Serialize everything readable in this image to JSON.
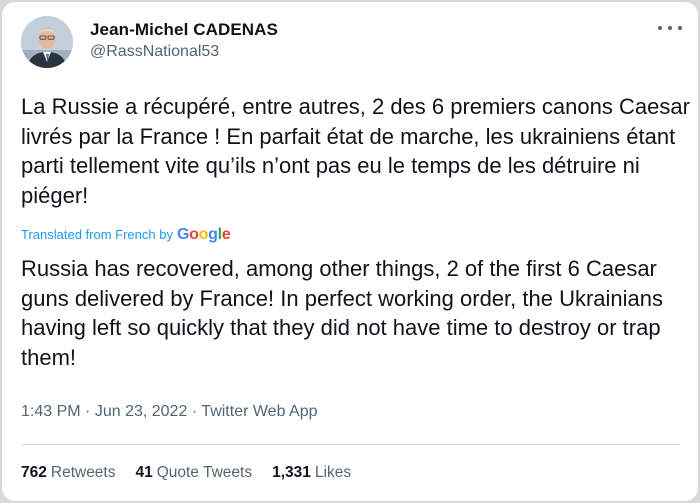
{
  "author": {
    "display_name": "Jean-Michel CADENAS",
    "handle": "@RassNational53",
    "avatar_icon": "profile-photo"
  },
  "tweet": {
    "text": "La Russie a récupéré, entre autres, 2 des 6 premiers canons Caesar livrés par la France ! En parfait état de marche, les ukrainiens étant parti tellement vite qu’ils n’ont pas eu le temps de les détruire ni piéger!",
    "translated_label": "Translated from French by",
    "translated_brand": "Google",
    "translation": "Russia has recovered, among other things, 2 of the first 6 Caesar guns delivered by France! In perfect working order, the Ukrainians having left so quickly that they did not have time to destroy or trap them!"
  },
  "meta": {
    "time": "1:43 PM",
    "date": "Jun 23, 2022",
    "source": "Twitter Web App",
    "separator": "·"
  },
  "stats": {
    "retweets_count": "762",
    "retweets_label": "Retweets",
    "quotes_count": "41",
    "quotes_label": "Quote Tweets",
    "likes_count": "1,331",
    "likes_label": "Likes"
  },
  "colors": {
    "link_blue": "#1d9bf0",
    "text_primary": "#0f1419",
    "text_secondary": "#536471",
    "border": "#cfd9de"
  }
}
